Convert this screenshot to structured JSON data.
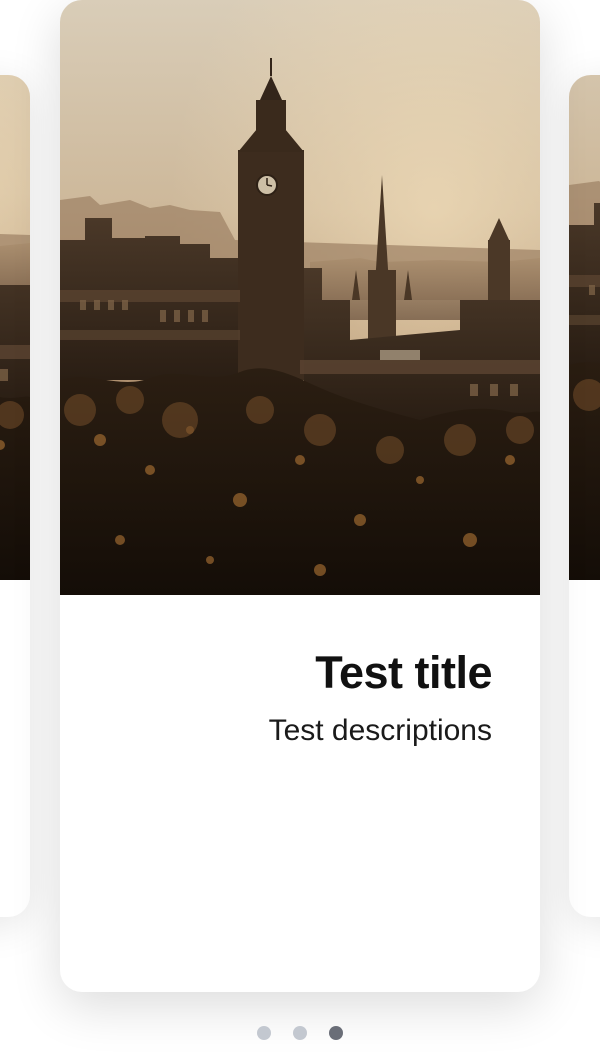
{
  "carousel": {
    "active_index": 2,
    "slides": [
      {
        "title": "Test title",
        "description": "Test descriptions"
      }
    ],
    "image_alt": "city-skyline-photo"
  },
  "pagination": {
    "count": 3,
    "active": 2
  },
  "colors": {
    "dot_inactive": "#c3c8d0",
    "dot_active": "#6a6e78",
    "title_text": "#111111"
  }
}
